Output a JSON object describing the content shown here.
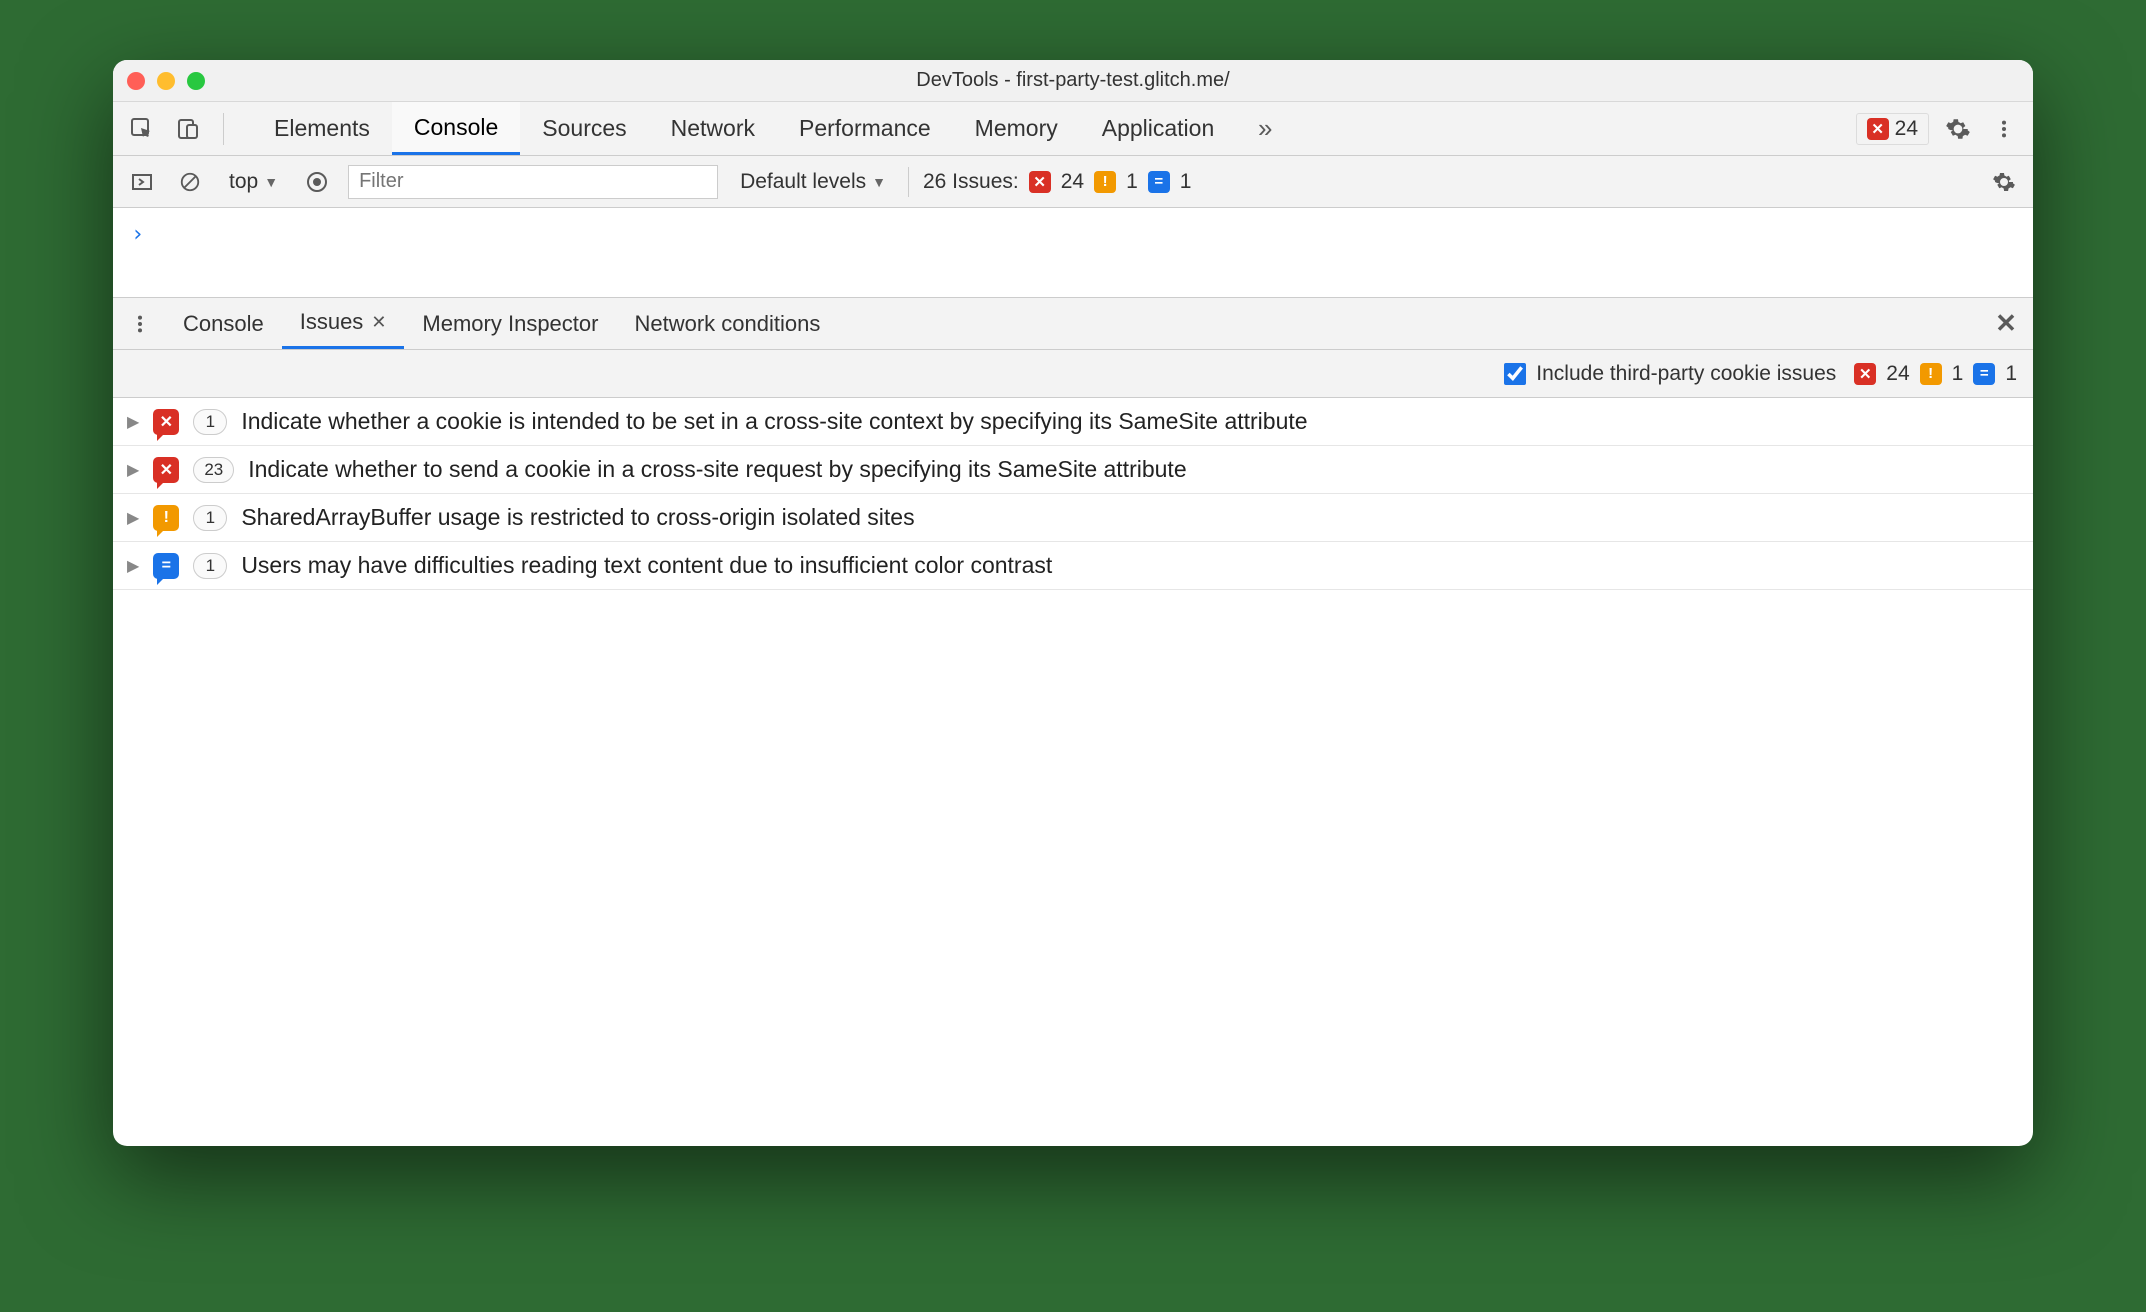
{
  "window": {
    "title": "DevTools - first-party-test.glitch.me/"
  },
  "main_tabs": {
    "items": [
      "Elements",
      "Console",
      "Sources",
      "Network",
      "Performance",
      "Memory",
      "Application"
    ],
    "active_index": 1,
    "overflow_glyph": "»"
  },
  "header_badge": {
    "error_count": "24"
  },
  "console_toolbar": {
    "context_label": "top",
    "filter_placeholder": "Filter",
    "levels_label": "Default levels",
    "issues_label": "26 Issues:",
    "counts": {
      "error": "24",
      "warn": "1",
      "info": "1"
    }
  },
  "prompt_glyph": "›",
  "drawer_tabs": {
    "items": [
      "Console",
      "Issues",
      "Memory Inspector",
      "Network conditions"
    ],
    "active_index": 1
  },
  "issues_bar": {
    "checkbox_label": "Include third-party cookie issues",
    "checked": true,
    "counts": {
      "error": "24",
      "warn": "1",
      "info": "1"
    }
  },
  "issues": [
    {
      "kind": "error",
      "count": "1",
      "title": "Indicate whether a cookie is intended to be set in a cross-site context by specifying its SameSite attribute"
    },
    {
      "kind": "error",
      "count": "23",
      "title": "Indicate whether to send a cookie in a cross-site request by specifying its SameSite attribute"
    },
    {
      "kind": "warn",
      "count": "1",
      "title": "SharedArrayBuffer usage is restricted to cross-origin isolated sites"
    },
    {
      "kind": "info",
      "count": "1",
      "title": "Users may have difficulties reading text content due to insufficient color contrast"
    }
  ],
  "glyphs": {
    "err": "✕",
    "warn": "!",
    "info": "="
  }
}
